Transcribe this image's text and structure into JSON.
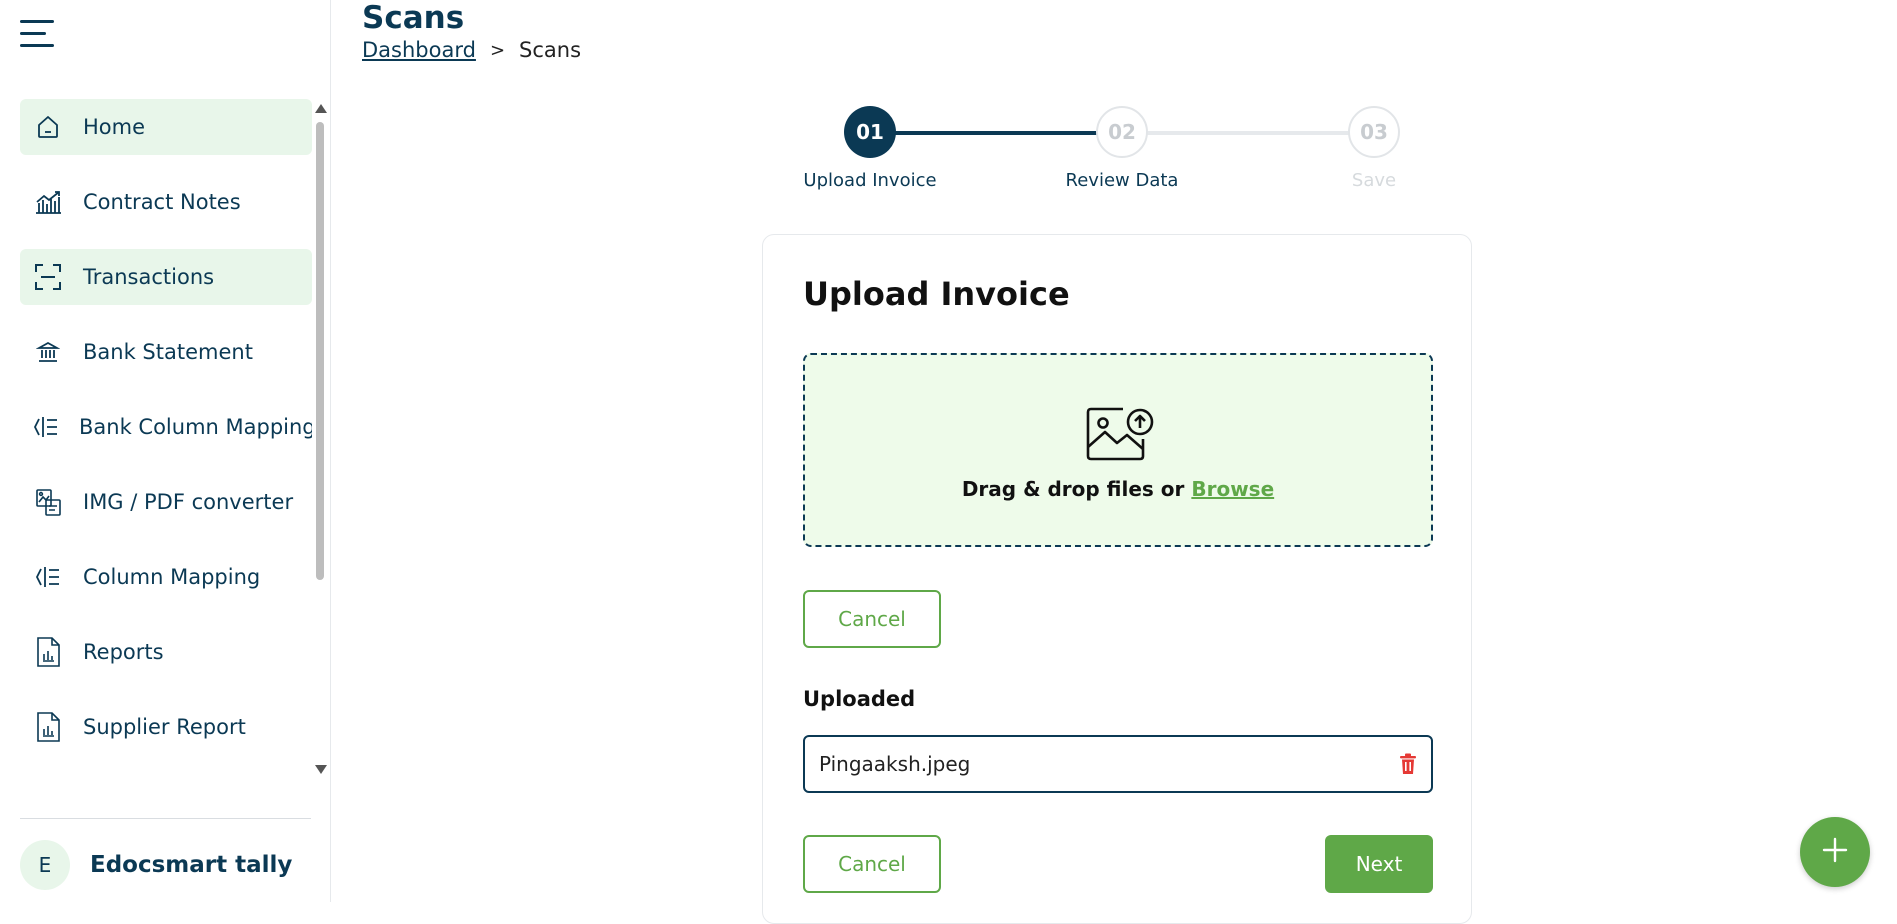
{
  "page": {
    "title": "Scans",
    "breadcrumb": {
      "root": "Dashboard",
      "separator": ">",
      "current": "Scans"
    }
  },
  "sidebar": {
    "items": [
      {
        "label": "Home",
        "icon": "home-icon",
        "active": true
      },
      {
        "label": "Contract Notes",
        "icon": "chart-icon",
        "active": false
      },
      {
        "label": "Transactions",
        "icon": "scan-icon",
        "active": true
      },
      {
        "label": "Bank Statement",
        "icon": "bank-icon",
        "active": false
      },
      {
        "label": "Bank Column Mapping",
        "icon": "column-mapping-icon",
        "active": false
      },
      {
        "label": "IMG / PDF converter",
        "icon": "converter-icon",
        "active": false
      },
      {
        "label": "Column Mapping",
        "icon": "column-mapping-icon",
        "active": false
      },
      {
        "label": "Reports",
        "icon": "report-icon",
        "active": false
      },
      {
        "label": "Supplier Report",
        "icon": "report-icon",
        "active": false
      }
    ],
    "user": {
      "initial": "E",
      "name": "Edocsmart tally"
    }
  },
  "stepper": {
    "steps": [
      {
        "number": "01",
        "label": "Upload Invoice",
        "state": "current"
      },
      {
        "number": "02",
        "label": "Review Data",
        "state": "upcoming"
      },
      {
        "number": "03",
        "label": "Save",
        "state": "disabled"
      }
    ]
  },
  "upload": {
    "title": "Upload Invoice",
    "dropzone_text": "Drag & drop files or ",
    "browse_label": "Browse",
    "cancel_label": "Cancel",
    "uploaded_title": "Uploaded",
    "file_name": "Pingaaksh.jpeg",
    "footer_cancel_label": "Cancel",
    "next_label": "Next"
  },
  "colors": {
    "primary": "#0b3954",
    "accent": "#5fa848",
    "active_bg": "#e8f6ea",
    "danger": "#e53935",
    "step_disabled": "#d6dadd"
  },
  "fab": {
    "icon": "plus-icon"
  }
}
